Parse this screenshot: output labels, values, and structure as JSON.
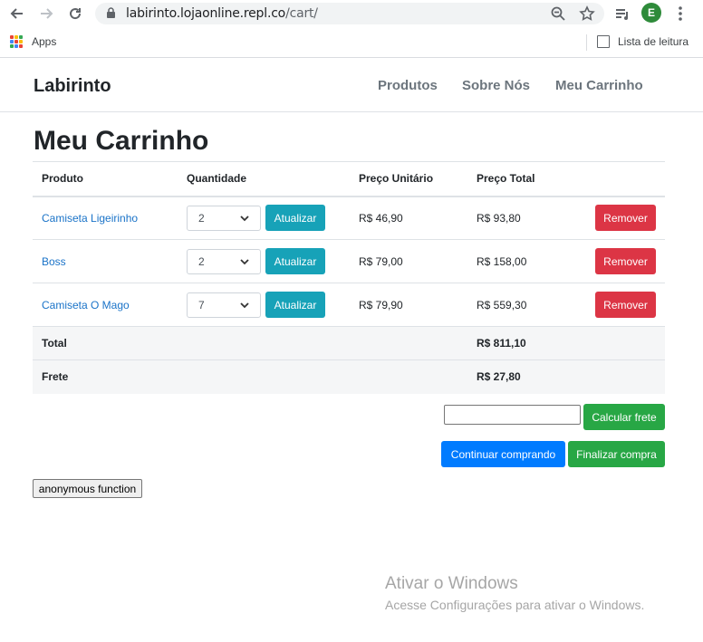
{
  "browser": {
    "url_host": "labirinto.lojaonline.repl.co",
    "url_path": "/cart/",
    "avatar_letter": "E",
    "bookmarks": {
      "apps_label": "Apps",
      "reading_list_label": "Lista de leitura"
    }
  },
  "navbar": {
    "brand": "Labirinto",
    "links": [
      "Produtos",
      "Sobre Nós",
      "Meu Carrinho"
    ]
  },
  "page_title": "Meu Carrinho",
  "cart": {
    "headers": [
      "Produto",
      "Quantidade",
      "Preço Unitário",
      "Preço Total"
    ],
    "rows": [
      {
        "product": "Camiseta Ligeirinho",
        "quantity": "2",
        "update_label": "Atualizar",
        "unit_price": "R$ 46,90",
        "total_price": "R$ 93,80",
        "remove_label": "Remover"
      },
      {
        "product": "Boss",
        "quantity": "2",
        "update_label": "Atualizar",
        "unit_price": "R$ 79,00",
        "total_price": "R$ 158,00",
        "remove_label": "Remover"
      },
      {
        "product": "Camiseta O Mago",
        "quantity": "7",
        "update_label": "Atualizar",
        "unit_price": "R$ 79,90",
        "total_price": "R$ 559,30",
        "remove_label": "Remover"
      }
    ],
    "total_label": "Total",
    "total_value": "R$ 811,10",
    "shipping_label": "Frete",
    "shipping_value": "R$ 27,80"
  },
  "actions": {
    "calc_shipping": "Calcular frete",
    "continue_shopping": "Continuar comprando",
    "checkout": "Finalizar compra",
    "anonymous": "anonymous function"
  },
  "watermark": {
    "title": "Ativar o Windows",
    "subtitle": "Acesse Configurações para ativar o Windows."
  },
  "colors": {
    "link": "#1a73c8",
    "info": "#17a2b8",
    "danger": "#dc3545",
    "success": "#28a745",
    "primary": "#007bff"
  }
}
